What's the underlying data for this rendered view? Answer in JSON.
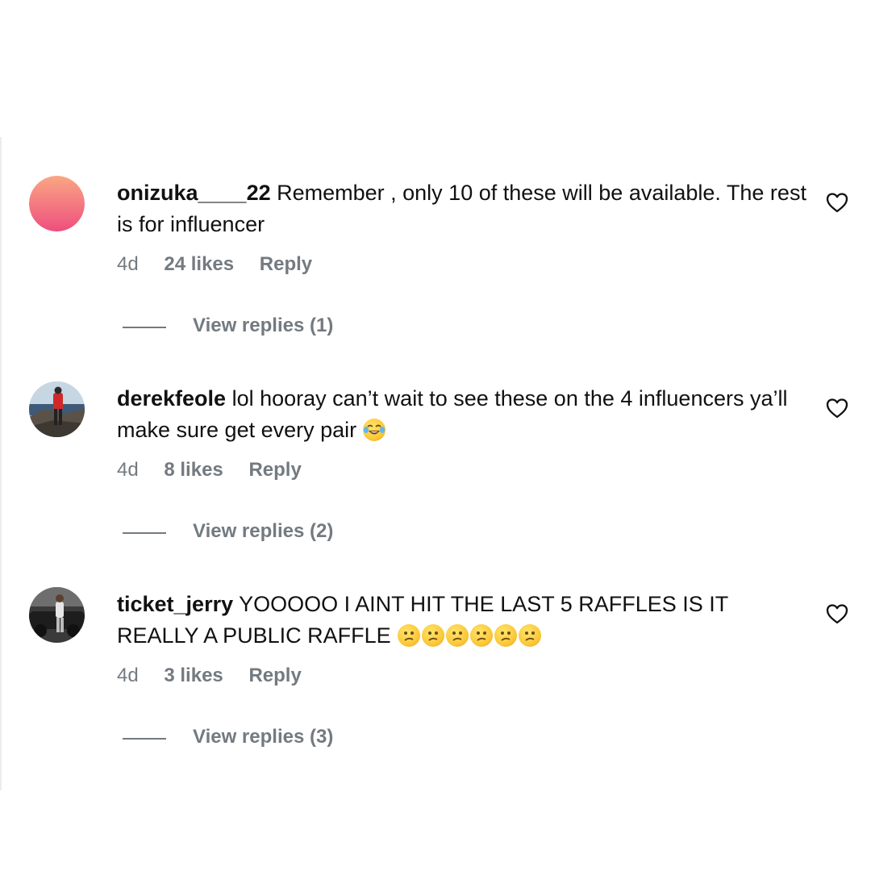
{
  "comments": [
    {
      "username": "onizuka____22",
      "text": " Remember , only 10 of these will be available. The rest is for influencer",
      "emoji": "",
      "time": "4d",
      "likes": "24 likes",
      "reply_label": "Reply",
      "view_replies": "View replies (1)",
      "avatar": "pink-gradient-avatar",
      "icon": "heart-outline-icon"
    },
    {
      "username": "derekfeole",
      "text": " lol hooray can’t wait to see these on the 4 influencers ya’ll make sure get every pair ",
      "emoji": "face-with-tears-of-joy",
      "time": "4d",
      "likes": "8 likes",
      "reply_label": "Reply",
      "view_replies": "View replies (2)",
      "avatar": "person-red-jacket-avatar",
      "icon": "heart-outline-icon"
    },
    {
      "username": "ticket_jerry",
      "text": " YOOOOO I AINT HIT THE LAST 5 RAFFLES IS IT REALLY A PUBLIC RAFFLE",
      "emoji": "confused-face x6",
      "time": "4d",
      "likes": "3 likes",
      "reply_label": "Reply",
      "view_replies": "View replies (3)",
      "avatar": "person-by-car-avatar",
      "icon": "heart-outline-icon"
    }
  ],
  "colors": {
    "text": "#111111",
    "muted": "#737a80",
    "background": "#ffffff"
  }
}
